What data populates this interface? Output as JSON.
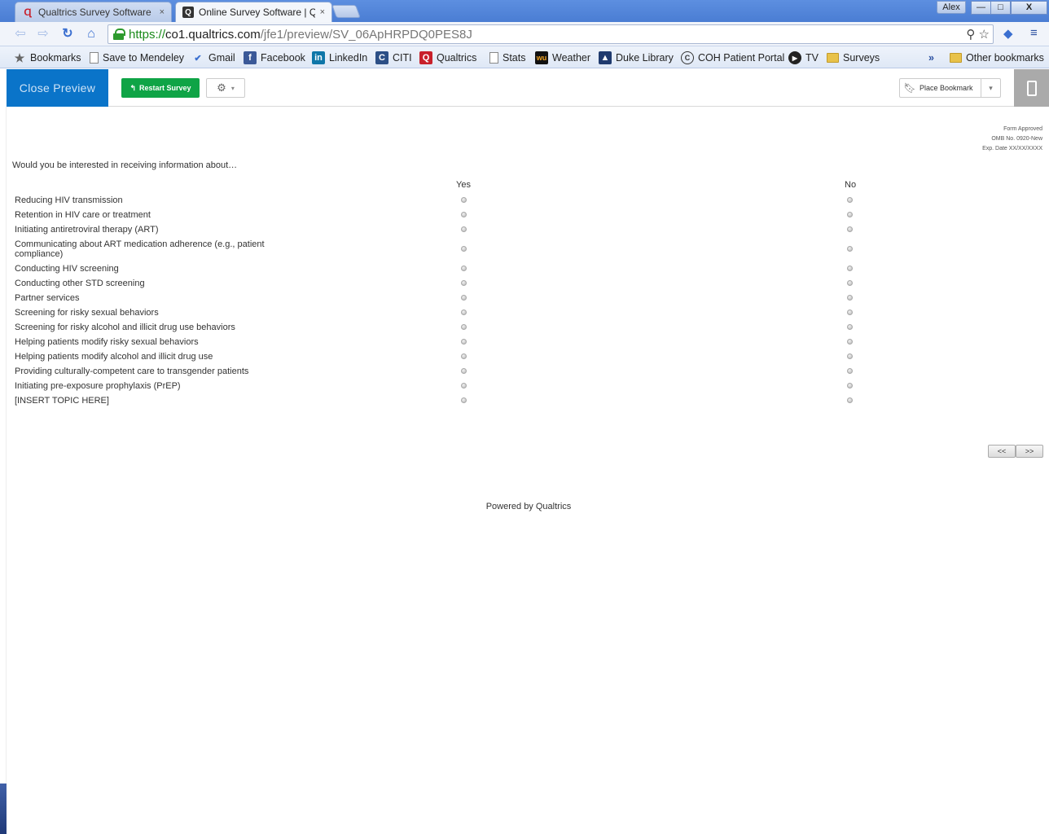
{
  "browser": {
    "tabs": [
      {
        "title": "Qualtrics Survey Software",
        "close": "×"
      },
      {
        "title": "Online Survey Software | Q",
        "close": "×"
      }
    ],
    "user": "Alex",
    "window_buttons": [
      "—",
      "□",
      "X"
    ],
    "url": {
      "scheme": "https://",
      "host": "co1.qualtrics.com",
      "path": "/jfe1/preview/SV_06ApHRPDQ0PES8J"
    },
    "bookmarks": [
      "Bookmarks",
      "Save to Mendeley",
      "Gmail",
      "Facebook",
      "LinkedIn",
      "CITI",
      "Qualtrics",
      "Stats",
      "Weather",
      "Duke Library",
      "COH Patient Portal",
      "TV",
      "Surveys"
    ],
    "overflow": "»",
    "other_bookmarks": "Other bookmarks"
  },
  "preview": {
    "close_label": "Close Preview",
    "restart_label": "Restart Survey",
    "bookmark_label": "Place Bookmark"
  },
  "survey": {
    "omb": [
      "Form Approved",
      "OMB No. 0920-New",
      "Exp. Date XX/XX/XXXX"
    ],
    "question": "Would you be interested in receiving information about…",
    "columns": [
      "Yes",
      "No"
    ],
    "rows": [
      "Reducing HIV transmission",
      "Retention in HIV care or treatment",
      "Initiating antiretroviral therapy (ART)",
      "Communicating about ART medication adherence (e.g., patient compliance)",
      "Conducting HIV screening",
      "Conducting other STD screening",
      "Partner services",
      "Screening for risky sexual behaviors",
      "Screening for risky alcohol and illicit drug use behaviors",
      "Helping patients modify risky sexual behaviors",
      "Helping patients modify alcohol and illicit drug use",
      "Providing culturally-competent care to transgender patients",
      "Initiating pre-exposure prophylaxis (PrEP)",
      "[INSERT TOPIC HERE]"
    ],
    "back_label": "<<",
    "next_label": ">>",
    "footer": "Powered by Qualtrics"
  }
}
